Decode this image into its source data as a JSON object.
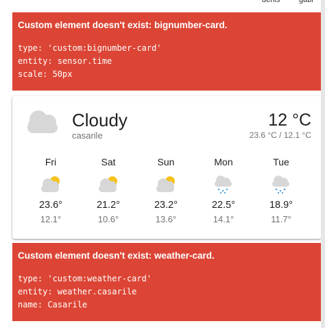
{
  "top_bar": {
    "user1": "denis",
    "user2": "gabi"
  },
  "error_card_1": {
    "title": "Custom element doesn't exist: bignumber-card.",
    "yaml": "type: 'custom:bignumber-card'\nentity: sensor.time\nscale: 50px"
  },
  "weather": {
    "condition": "Cloudy",
    "location": "casarile",
    "temperature": "12 °C",
    "range": "23.6 °C / 12.1 °C",
    "icon": "cloudy-icon",
    "forecast": [
      {
        "day": "Fri",
        "high": "23.6°",
        "low": "12.1°",
        "icon": "partly-cloudy-icon"
      },
      {
        "day": "Sat",
        "high": "21.2°",
        "low": "10.6°",
        "icon": "partly-cloudy-icon"
      },
      {
        "day": "Sun",
        "high": "23.2°",
        "low": "13.6°",
        "icon": "partly-cloudy-icon"
      },
      {
        "day": "Mon",
        "high": "22.5°",
        "low": "14.1°",
        "icon": "rainy-icon"
      },
      {
        "day": "Tue",
        "high": "18.9°",
        "low": "11.7°",
        "icon": "rainy-icon"
      }
    ]
  },
  "error_card_2": {
    "title": "Custom element doesn't exist: weather-card.",
    "yaml": "type: 'custom:weather-card'\nentity: weather.casarile\nname: Casarile"
  },
  "colors": {
    "error_bg": "#dc4535",
    "cloud_main": "#d7d7d7",
    "sun": "#f6c21b",
    "rain": "#55a5dd"
  }
}
